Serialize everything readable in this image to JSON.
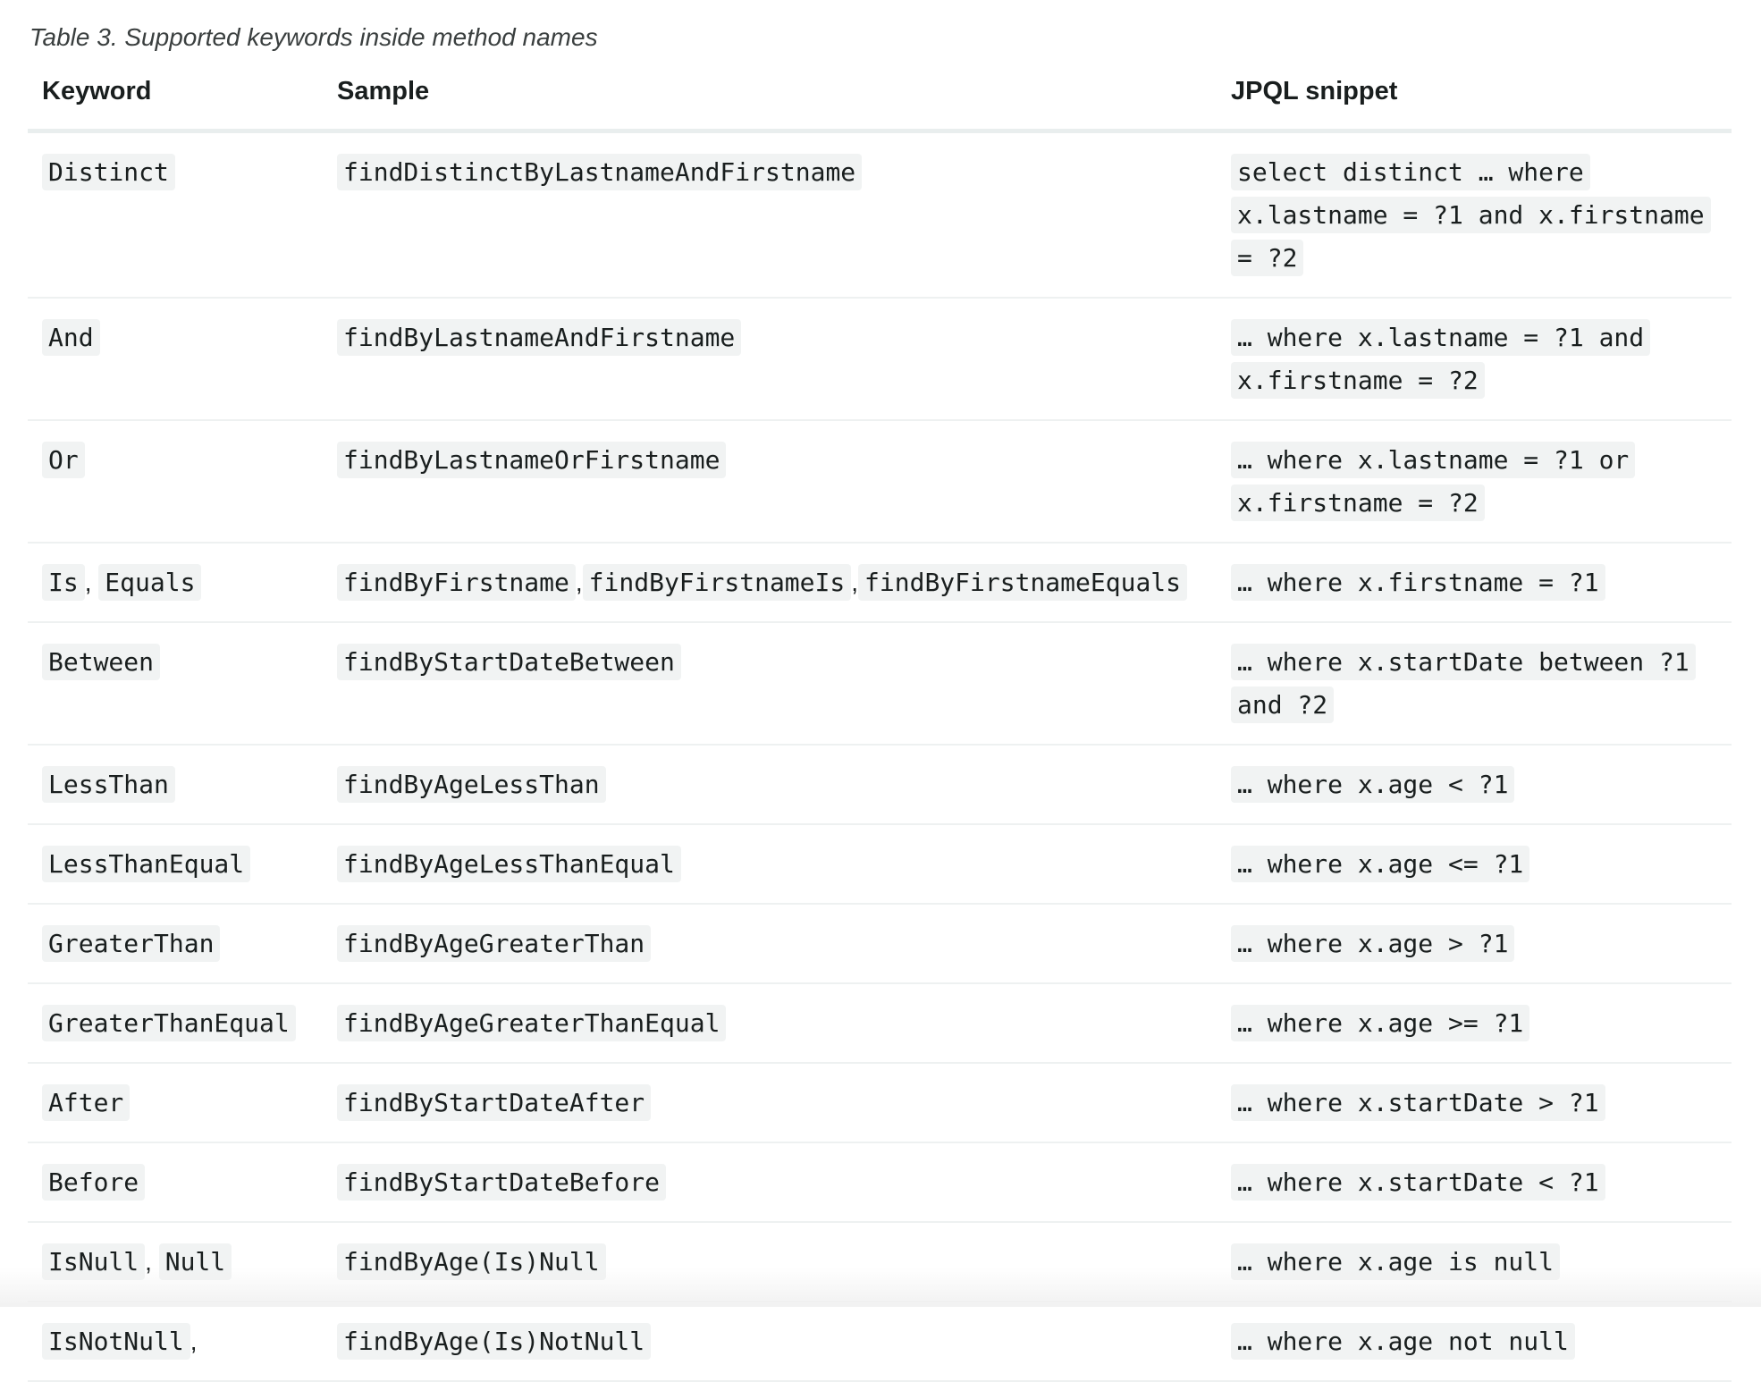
{
  "caption": "Table 3. Supported keywords inside method names",
  "table": {
    "headers": {
      "keyword": "Keyword",
      "sample": "Sample",
      "jpql": "JPQL snippet"
    },
    "rows": [
      {
        "keywords": [
          "Distinct"
        ],
        "samples": [
          "findDistinctByLastnameAndFirstname"
        ],
        "jpql": "select distinct … where x.lastname = ?1 and x.firstname = ?2"
      },
      {
        "keywords": [
          "And"
        ],
        "samples": [
          "findByLastnameAndFirstname"
        ],
        "jpql": "… where x.lastname = ?1 and x.firstname = ?2"
      },
      {
        "keywords": [
          "Or"
        ],
        "samples": [
          "findByLastnameOrFirstname"
        ],
        "jpql": "… where x.lastname = ?1 or x.firstname = ?2"
      },
      {
        "keywords": [
          "Is",
          "Equals"
        ],
        "samples": [
          "findByFirstname",
          "findByFirstnameIs",
          "findByFirstnameEquals"
        ],
        "jpql": "… where x.firstname = ?1"
      },
      {
        "keywords": [
          "Between"
        ],
        "samples": [
          "findByStartDateBetween"
        ],
        "jpql": "… where x.startDate between ?1 and ?2"
      },
      {
        "keywords": [
          "LessThan"
        ],
        "samples": [
          "findByAgeLessThan"
        ],
        "jpql": "… where x.age < ?1"
      },
      {
        "keywords": [
          "LessThanEqual"
        ],
        "samples": [
          "findByAgeLessThanEqual"
        ],
        "jpql": "… where x.age <= ?1"
      },
      {
        "keywords": [
          "GreaterThan"
        ],
        "samples": [
          "findByAgeGreaterThan"
        ],
        "jpql": "… where x.age > ?1"
      },
      {
        "keywords": [
          "GreaterThanEqual"
        ],
        "samples": [
          "findByAgeGreaterThanEqual"
        ],
        "jpql": "… where x.age >= ?1"
      },
      {
        "keywords": [
          "After"
        ],
        "samples": [
          "findByStartDateAfter"
        ],
        "jpql": "… where x.startDate > ?1"
      },
      {
        "keywords": [
          "Before"
        ],
        "samples": [
          "findByStartDateBefore"
        ],
        "jpql": "… where x.startDate < ?1"
      },
      {
        "keywords": [
          "IsNull",
          "Null"
        ],
        "samples": [
          "findByAge(Is)Null"
        ],
        "jpql": "… where x.age is null"
      },
      {
        "keywords": [
          "IsNotNull"
        ],
        "keywords_trailing_comma": ",",
        "samples": [
          "findByAge(Is)NotNull"
        ],
        "jpql": "… where x.age not null"
      }
    ]
  }
}
